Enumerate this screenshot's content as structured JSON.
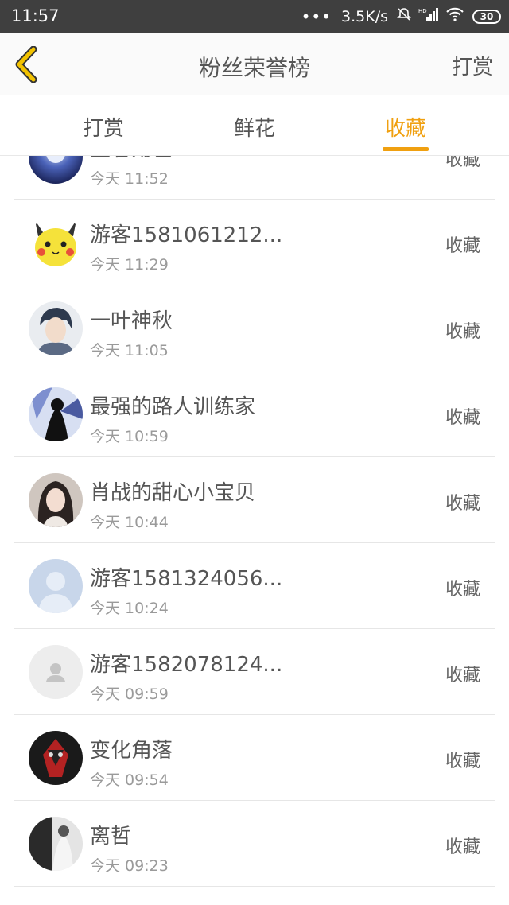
{
  "status": {
    "time": "11:57",
    "speed": "3.5K/s",
    "battery": "30"
  },
  "header": {
    "title": "粉丝荣誉榜",
    "action": "打赏"
  },
  "tabs": [
    {
      "label": "打赏"
    },
    {
      "label": "鲜花"
    },
    {
      "label": "收藏",
      "active": true
    }
  ],
  "accent_color": "#f0a010",
  "rows": [
    {
      "name": "王者角色",
      "time": "今天 11:52",
      "action": "收藏",
      "avatar": "anime-blue"
    },
    {
      "name": "游客1581061212...",
      "time": "今天 11:29",
      "action": "收藏",
      "avatar": "pikachu"
    },
    {
      "name": "一叶神秋",
      "time": "今天 11:05",
      "action": "收藏",
      "avatar": "anime-man"
    },
    {
      "name": "最强的路人训练家",
      "time": "今天 10:59",
      "action": "收藏",
      "avatar": "dark-figure"
    },
    {
      "name": "肖战的甜心小宝贝",
      "time": "今天 10:44",
      "action": "收藏",
      "avatar": "girl-photo"
    },
    {
      "name": "游客1581324056...",
      "time": "今天 10:24",
      "action": "收藏",
      "avatar": "default-blue"
    },
    {
      "name": "游客1582078124...",
      "time": "今天 09:59",
      "action": "收藏",
      "avatar": "default-gray"
    },
    {
      "name": "变化角落",
      "time": "今天 09:54",
      "action": "收藏",
      "avatar": "dark-art"
    },
    {
      "name": "离哲",
      "time": "今天 09:23",
      "action": "收藏",
      "avatar": "bw-photo"
    }
  ]
}
